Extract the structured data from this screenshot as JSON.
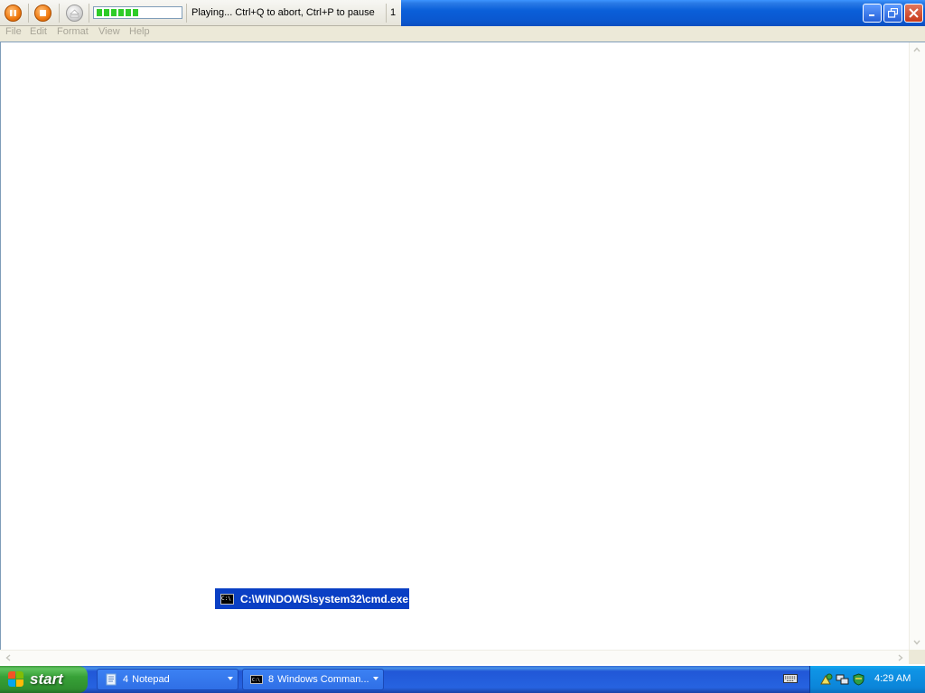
{
  "macro_toolbar": {
    "pause_icon": "pause-icon",
    "stop_icon": "stop-icon",
    "eject_icon": "eject-icon",
    "progress_fraction": 0.5,
    "status": "Playing... Ctrl+Q to abort, Ctrl+P to pause",
    "count": "1"
  },
  "window_buttons": [
    "minimize-icon",
    "restore-icon",
    "close-icon"
  ],
  "menu": {
    "file": "File",
    "edit": "Edit",
    "format": "Format",
    "view": "View",
    "help": "Help"
  },
  "editor": {
    "content": ""
  },
  "window_label": {
    "title": "C:\\WINDOWS\\system32\\cmd.exe",
    "icon": "console-icon"
  },
  "taskbar": {
    "start_label": "start",
    "buttons": [
      {
        "count": "4",
        "label": "Notepad",
        "icon": "notepad-icon"
      },
      {
        "count": "8",
        "label": "Windows Comman...",
        "icon": "console-icon"
      }
    ],
    "clock": "4:29 AM"
  },
  "colors": {
    "title_blue": "#0a5fd9",
    "taskbar_blue": "#2663e0",
    "start_green": "#37a137",
    "tray_blue": "#0b85d9",
    "progress_green": "#2ecc28",
    "label_blue": "#0a3fc4"
  }
}
